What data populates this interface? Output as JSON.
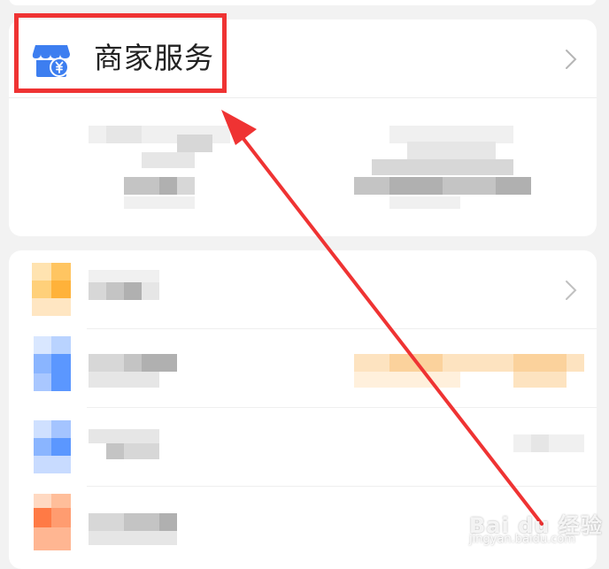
{
  "merchant_section": {
    "title": "商家服务",
    "icon": "shop-icon",
    "icon_color": "#3d7ef0"
  },
  "annotation": {
    "box_color": "#ef3333",
    "arrow_color": "#ef3333"
  },
  "watermark": {
    "brand": "Bai du 经验",
    "url": "jingyan.baidu.com"
  }
}
